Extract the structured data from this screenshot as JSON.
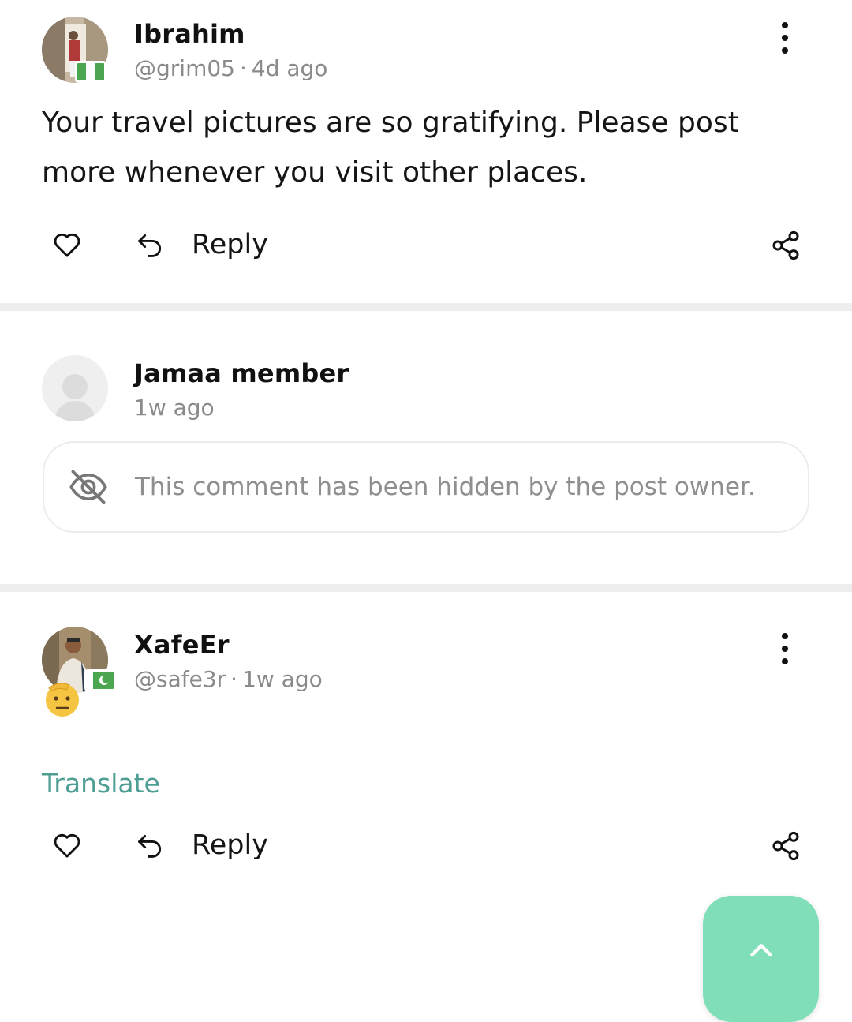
{
  "comments": [
    {
      "name": "Ibrahim",
      "handle": "@grim05",
      "separator": "·",
      "time": "4d ago",
      "flag": "nigeria-flag",
      "text": "Your travel pictures are so gratifying. Please post more whenever you visit other places.",
      "reply_label": "Reply"
    },
    {
      "name": "Jamaa member",
      "time": "1w ago",
      "hidden_message": "This comment has been hidden by the post owner."
    },
    {
      "name": "XafeEr",
      "handle": "@safe3r",
      "separator": "·",
      "time": "1w ago",
      "flag": "pakistan-flag",
      "emoji": "saluting-face-emoji",
      "translate_label": "Translate",
      "reply_label": "Reply"
    }
  ],
  "icons": {
    "like": "heart-icon",
    "reply": "reply-arrow-icon",
    "share": "share-icon",
    "more": "more-vertical-icon",
    "hidden": "eye-off-icon",
    "scroll_top": "chevron-up-icon"
  },
  "colors": {
    "accent_teal": "#4e9e93",
    "fab_green": "#80dfb9",
    "muted_text": "#8a8a8a",
    "divider": "#eeeeee"
  }
}
